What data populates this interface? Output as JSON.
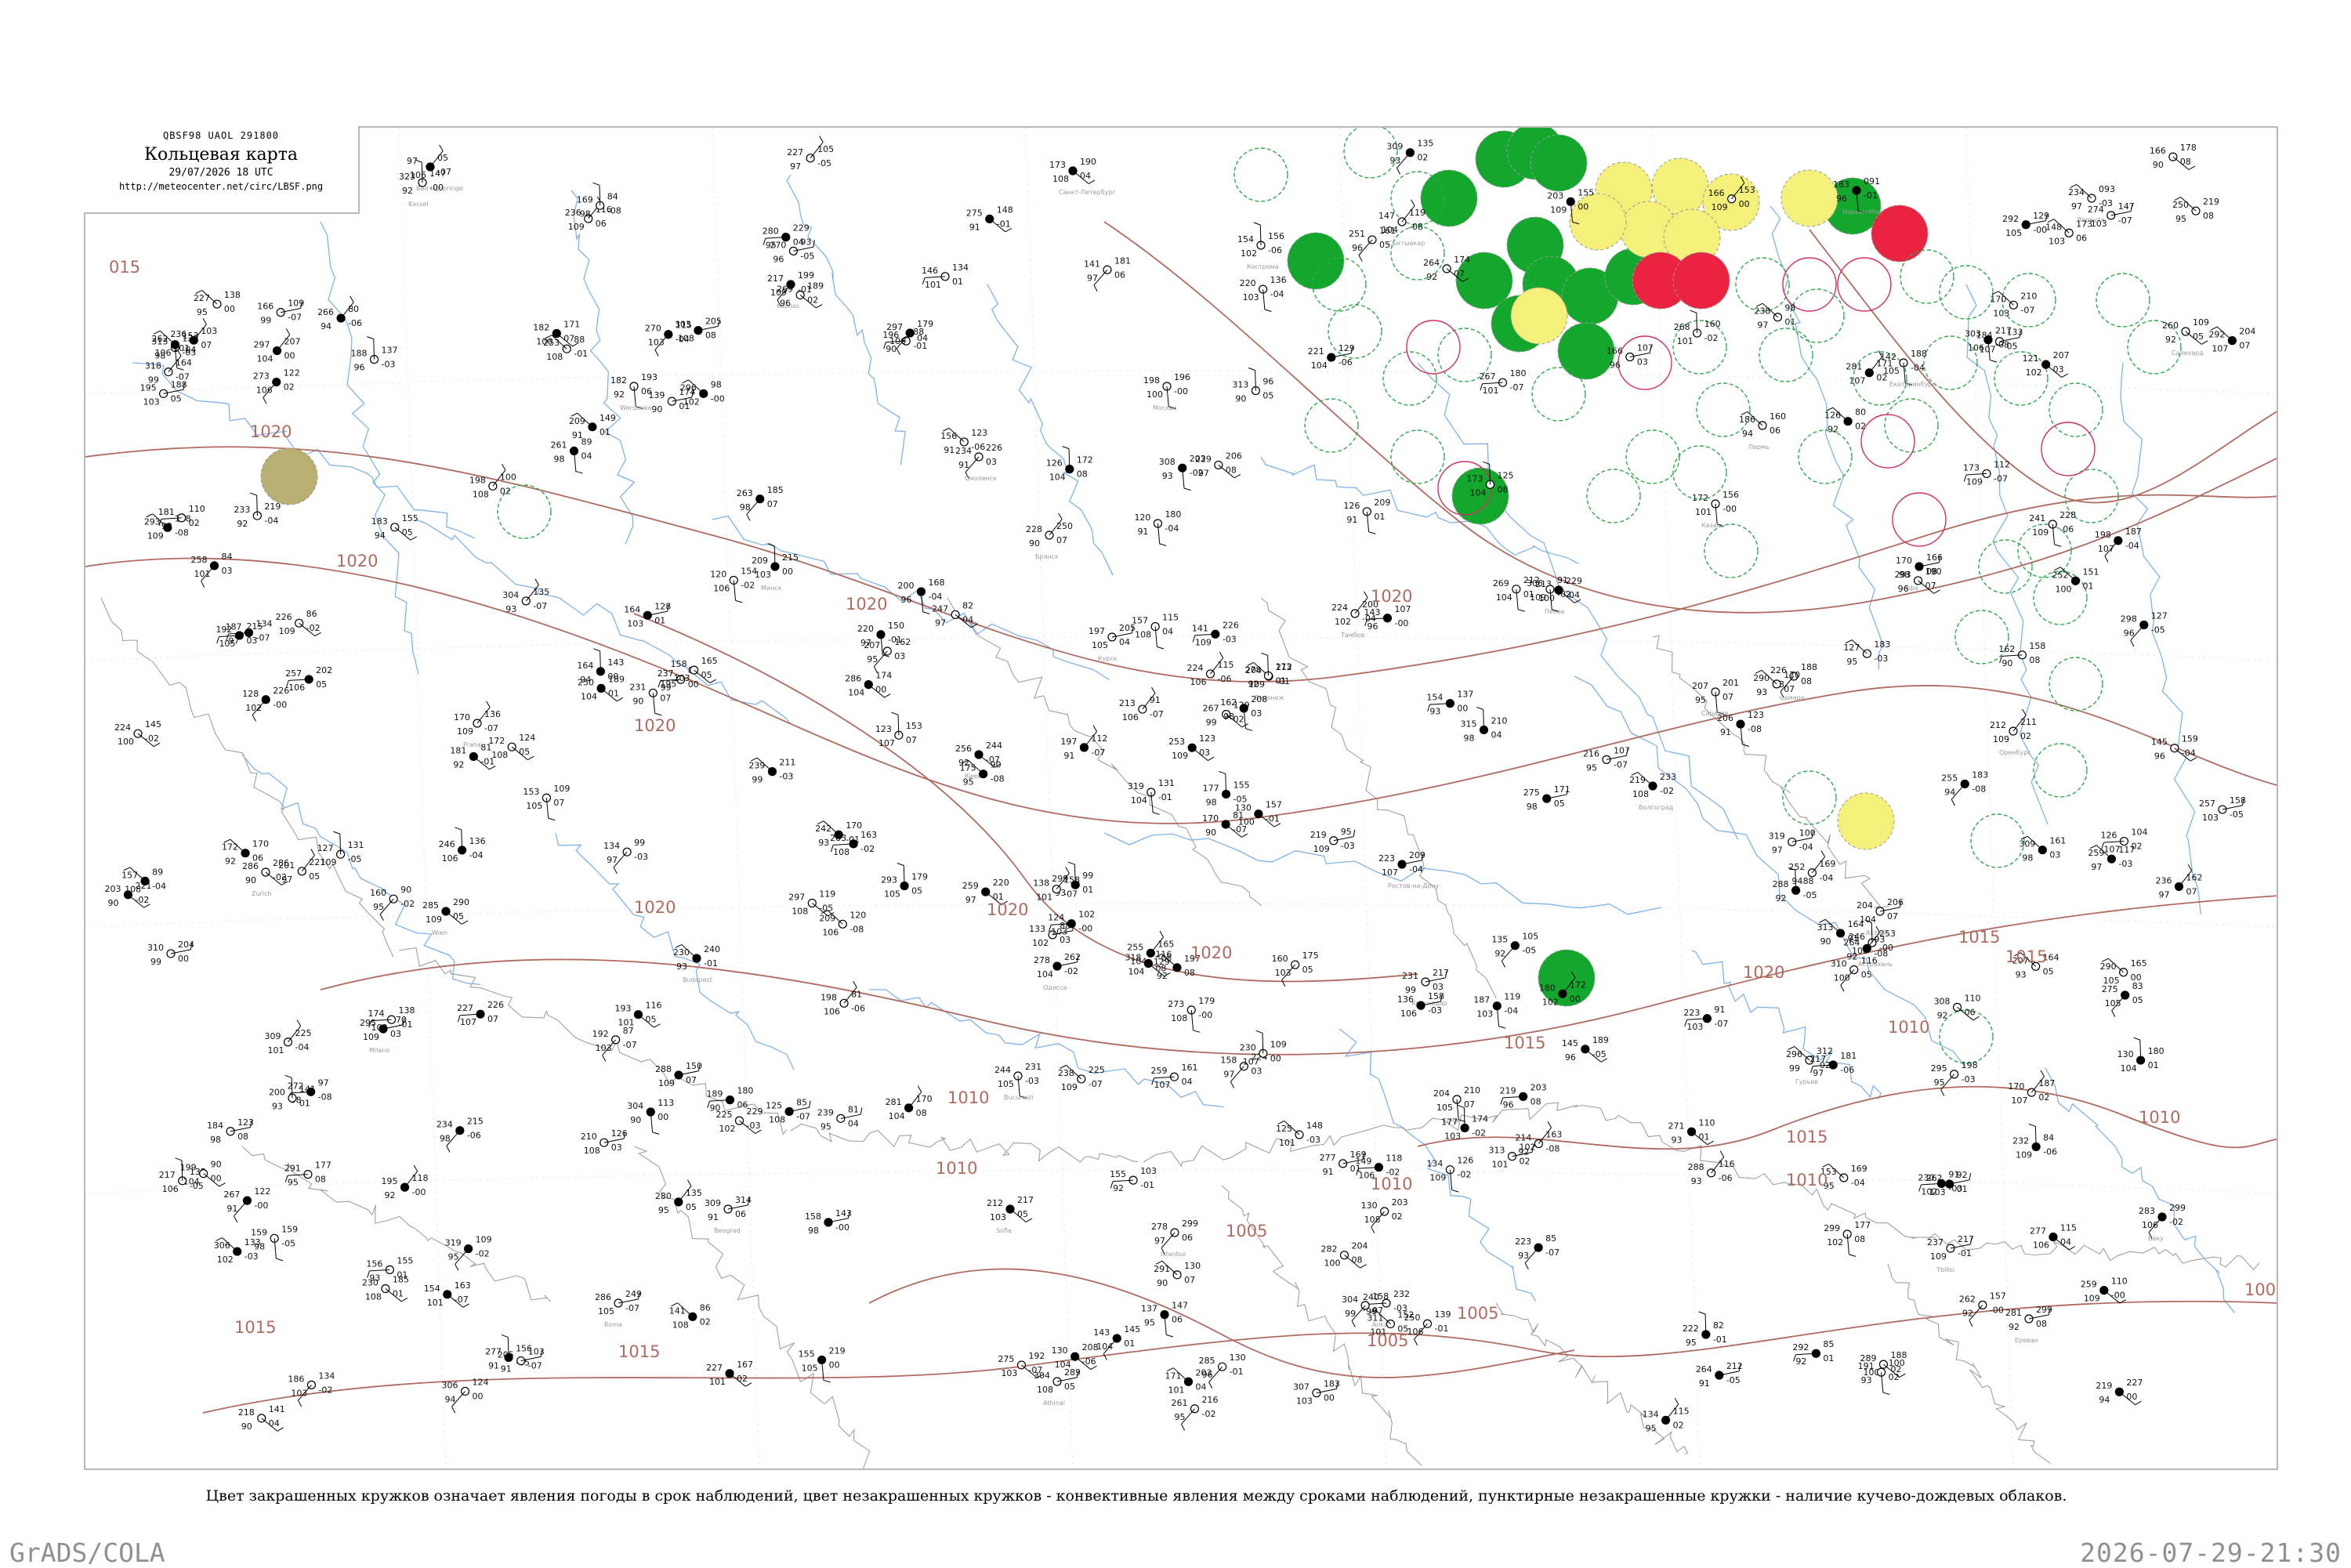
{
  "header": {
    "code": "QBSF98  UAOL  291800",
    "title": "Кольцевая карта",
    "datetime": "29/07/2026 18 UTC",
    "url": "http://meteocenter.net/circ/LBSF.png"
  },
  "caption": "Цвет закрашенных кружков означает явления погоды в срок наблюдений, цвет незакрашенных кружков - конвективные явления между сроками наблюдений, пунктирные незакрашенные кружки - наличие кучево-дождевых облаков.",
  "footer": {
    "left": "GrADS/COLA",
    "right": "2026-07-29-21:30"
  },
  "colors": {
    "isobar": "#b06b60",
    "river": "#7fb3e8",
    "border": "#a0a0a0",
    "storm_fill": "#13a82d",
    "rain_fill": "#f4f07a",
    "shower_fill": "#ea2341",
    "fog_fill": "#b8b070",
    "cb_circle": "#2ea84a",
    "conv_circle": "#d03060"
  },
  "isobar_labels": [
    "015",
    "1020",
    "1020",
    "1020",
    "1020",
    "1020",
    "1020",
    "1020",
    "1020",
    "1020",
    "1015",
    "1015",
    "1015",
    "1015",
    "1010",
    "1010",
    "1010",
    "1010",
    "1010",
    "1005",
    "1005",
    "1005",
    "1010",
    "1015",
    "1015",
    "100"
  ],
  "stations": [
    {
      "name": "Bad Lipspringe",
      "v": [
        "97",
        "05"
      ]
    },
    {
      "name": "Kassel",
      "v": [
        "323",
        "147"
      ]
    },
    {
      "name": "Warszawa",
      "v": [
        "182",
        "193"
      ]
    },
    {
      "name": "Kaunas",
      "v": [
        "217",
        "199"
      ]
    },
    {
      "name": "Санкт-Петербург",
      "v": [
        "173",
        "190"
      ]
    },
    {
      "name": "Кострома",
      "v": [
        "154",
        "156"
      ]
    },
    {
      "name": "Москва",
      "v": [
        "198",
        "196"
      ]
    },
    {
      "name": "Смоленск",
      "v": [
        "234",
        "226"
      ]
    },
    {
      "name": "Брянск",
      "v": [
        "228",
        "250"
      ]
    },
    {
      "name": "Курск",
      "v": [
        "197",
        "205"
      ]
    },
    {
      "name": "Воронеж",
      "v": [
        "204",
        "212"
      ]
    },
    {
      "name": "Тамбов",
      "v": [
        "224",
        "200"
      ]
    },
    {
      "name": "Пенза",
      "v": [
        "213",
        "229"
      ]
    },
    {
      "name": "Саратов",
      "v": [
        "207",
        "201"
      ]
    },
    {
      "name": "Волгоград",
      "v": [
        "219",
        "233"
      ]
    },
    {
      "name": "Астрахань",
      "v": [
        "246",
        "253"
      ]
    },
    {
      "name": "Ростов-на-Дону",
      "v": [
        "223",
        "209"
      ]
    },
    {
      "name": "Краснодар",
      "v": [
        "231",
        "217"
      ]
    },
    {
      "name": "Сочи",
      "v": [
        "204",
        "210"
      ]
    },
    {
      "name": "Киев",
      "v": [
        "256",
        "244"
      ]
    },
    {
      "name": "Одесса",
      "v": [
        "278",
        "262"
      ]
    },
    {
      "name": "Минск",
      "v": [
        "209",
        "215"
      ]
    },
    {
      "name": "Praha",
      "v": [
        "170",
        "136"
      ]
    },
    {
      "name": "Wien",
      "v": [
        "285",
        "290"
      ]
    },
    {
      "name": "Budapest",
      "v": [
        "230",
        "240"
      ]
    },
    {
      "name": "Beograd",
      "v": [
        "309",
        "314"
      ]
    },
    {
      "name": "Bucuresti",
      "v": [
        "244",
        "231"
      ]
    },
    {
      "name": "Sofia",
      "v": [
        "212",
        "217"
      ]
    },
    {
      "name": "Istanbul",
      "v": [
        "278",
        "299"
      ]
    },
    {
      "name": "Ankara",
      "v": [
        "240",
        "232"
      ]
    },
    {
      "name": "Athinai",
      "v": [
        "304",
        "289"
      ]
    },
    {
      "name": "Roma",
      "v": [
        "286",
        "249"
      ]
    },
    {
      "name": "Milano",
      "v": [
        "295",
        "270"
      ]
    },
    {
      "name": "Zurich",
      "v": [
        "286",
        "286"
      ]
    },
    {
      "name": "Tbilisi",
      "v": [
        "237",
        "217"
      ]
    },
    {
      "name": "Ереван",
      "v": [
        "281",
        "299"
      ]
    },
    {
      "name": "Баку",
      "v": [
        "283",
        "299"
      ]
    },
    {
      "name": "Оренбург",
      "v": [
        "212",
        "211"
      ]
    },
    {
      "name": "Уфа",
      "v": [
        "170",
        "166"
      ]
    },
    {
      "name": "Самара",
      "v": [
        "226",
        "188"
      ]
    },
    {
      "name": "Казань",
      "v": [
        "172",
        "156"
      ]
    },
    {
      "name": "Пермь",
      "v": [
        "186",
        "160"
      ]
    },
    {
      "name": "Екатеринбург",
      "v": [
        "142",
        "188"
      ]
    },
    {
      "name": "Сыктывкар",
      "v": [
        "147",
        "119"
      ]
    },
    {
      "name": "Нарьян-Мар",
      "v": [
        "183",
        "091"
      ]
    },
    {
      "name": "Воркута",
      "v": [
        "234",
        "093"
      ]
    },
    {
      "name": "Салехард",
      "v": [
        "260",
        "109"
      ]
    },
    {
      "name": "Актобе",
      "v": [
        "204",
        "206"
      ]
    },
    {
      "name": "Гурьев",
      "v": [
        "296",
        "312"
      ]
    }
  ]
}
